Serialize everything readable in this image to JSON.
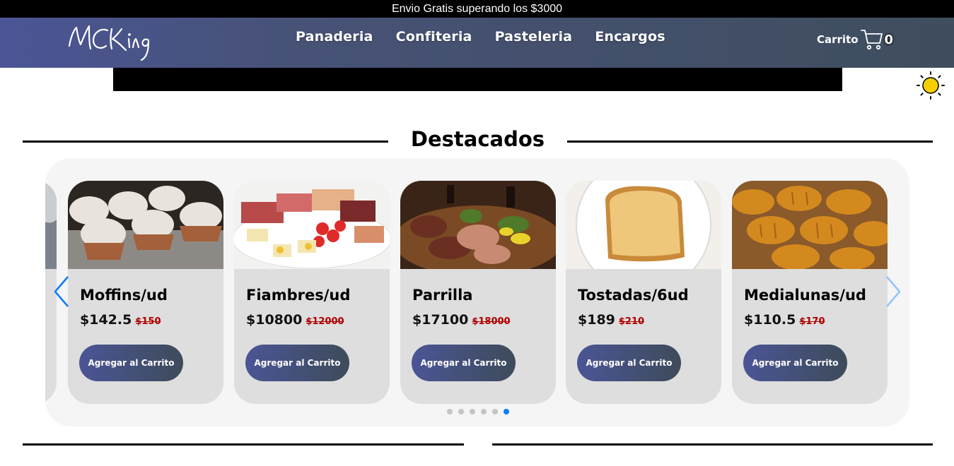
{
  "topbar": {
    "text": "Envio Gratis superando los $3000"
  },
  "header": {
    "logo_text": "MCKing",
    "nav": [
      "Panaderia",
      "Confiteria",
      "Pasteleria",
      "Encargos"
    ],
    "cart_label": "Carrito",
    "cart_count": "0"
  },
  "section": {
    "title": "Destacados"
  },
  "products": [
    {
      "name": "Moffins/ud",
      "price": "$142.5",
      "old_price": "$150",
      "button": "Agregar al Carrito",
      "image": "muffins"
    },
    {
      "name": "Fiambres/ud",
      "price": "$10800",
      "old_price": "$12000",
      "button": "Agregar al Carrito",
      "image": "cold-cuts"
    },
    {
      "name": "Parrilla",
      "price": "$17100",
      "old_price": "$18000",
      "button": "Agregar al Carrito",
      "image": "grill-platter"
    },
    {
      "name": "Tostadas/6ud",
      "price": "$189",
      "old_price": "$210",
      "button": "Agregar al Carrito",
      "image": "toast"
    },
    {
      "name": "Medialunas/ud",
      "price": "$110.5",
      "old_price": "$170",
      "button": "Agregar al Carrito",
      "image": "croissants"
    }
  ],
  "carousel": {
    "dot_count": 6,
    "active_dot": 6
  },
  "colors": {
    "header_start": "#4b5596",
    "header_end": "#3f4d5e",
    "accent_dot": "#0a7cff",
    "old_price": "#b00000",
    "sun": "#f5d000"
  },
  "icons": {
    "cart": "cart-icon",
    "theme": "sun-icon",
    "prev": "chevron-left-icon",
    "next": "chevron-right-icon"
  }
}
